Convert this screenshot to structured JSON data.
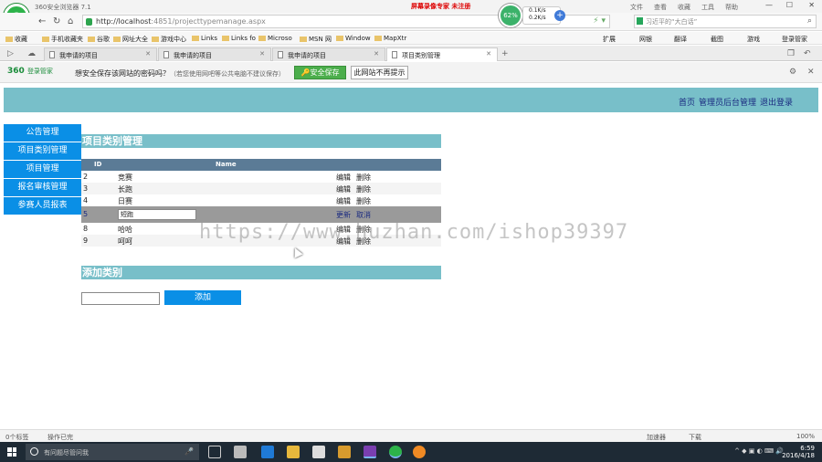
{
  "browser": {
    "window_title": "360安全浏览器 7.1",
    "rec_notice": "屏幕录像专家 未注册",
    "menus": [
      "文件",
      "查看",
      "收藏",
      "工具",
      "帮助"
    ],
    "url_host": "http://localhost",
    "url_rest": ":4851/projecttypemanage.aspx",
    "search_placeholder": "习近平的“大白话”",
    "perf": {
      "percent": "62%",
      "up": "0.1K/s",
      "down": "0.2K/s"
    },
    "bookmarks": [
      "收藏",
      "手机收藏夹",
      "谷歌",
      "网址大全",
      "游戏中心",
      "Links",
      "Links fo",
      "Microso",
      "MSN 网",
      "Window",
      "MapXtr",
      "扩展",
      "网银",
      "翻译",
      "截图",
      "游戏",
      "登录管家"
    ],
    "tabs": [
      {
        "label": "我申请的项目",
        "active": false
      },
      {
        "label": "我申请的项目",
        "active": false
      },
      {
        "label": "我申请的项目",
        "active": false
      },
      {
        "label": "项目类别管理",
        "active": true
      }
    ],
    "tab_add": "+"
  },
  "password_bar": {
    "brand": "360",
    "brand_sub": "登录管家",
    "question": "想安全保存该网站的密码吗？",
    "hint": "（若您使用网吧等公共电脑不建议保存）",
    "save_label": "安全保存",
    "never_label": "此网站不再提示"
  },
  "site": {
    "top_links": [
      "首页",
      "管理员后台管理",
      "退出登录"
    ],
    "nav": [
      "公告管理",
      "项目类别管理",
      "项目管理",
      "报名审核管理",
      "参赛人员报表"
    ],
    "section_title": "项目类别管理",
    "columns": [
      "ID",
      "Name"
    ],
    "rows": [
      {
        "id": "2",
        "name": "竞赛",
        "actions": [
          "编辑",
          "删除"
        ]
      },
      {
        "id": "3",
        "name": "长跑",
        "actions": [
          "编辑",
          "删除"
        ]
      },
      {
        "id": "4",
        "name": "日赛",
        "actions": [
          "编辑",
          "删除"
        ]
      },
      {
        "id": "5",
        "name": "短跑",
        "actions": [
          "更新",
          "取消"
        ],
        "editing": true
      },
      {
        "id": "8",
        "name": "哈哈",
        "actions": [
          "编辑",
          "删除"
        ]
      },
      {
        "id": "9",
        "name": "呵呵",
        "actions": [
          "编辑",
          "删除"
        ]
      }
    ],
    "add_title": "添加类别",
    "add_value": "",
    "add_button": "添加"
  },
  "watermark": "https://www.huzhan.com/ishop39397",
  "statusbar": {
    "left1": "0个标签",
    "left2": "操作已完",
    "speed": "加速器",
    "download": "下载",
    "zoom": "100%"
  },
  "taskbar": {
    "search_placeholder": "有问题尽管问我",
    "time": "6:59",
    "date": "2016/4/18"
  },
  "colors": {
    "header": "#78bfc9",
    "nav": "#0a8fe6",
    "grid_header": "#5b7b96",
    "edit_row": "#9a9a9a"
  }
}
